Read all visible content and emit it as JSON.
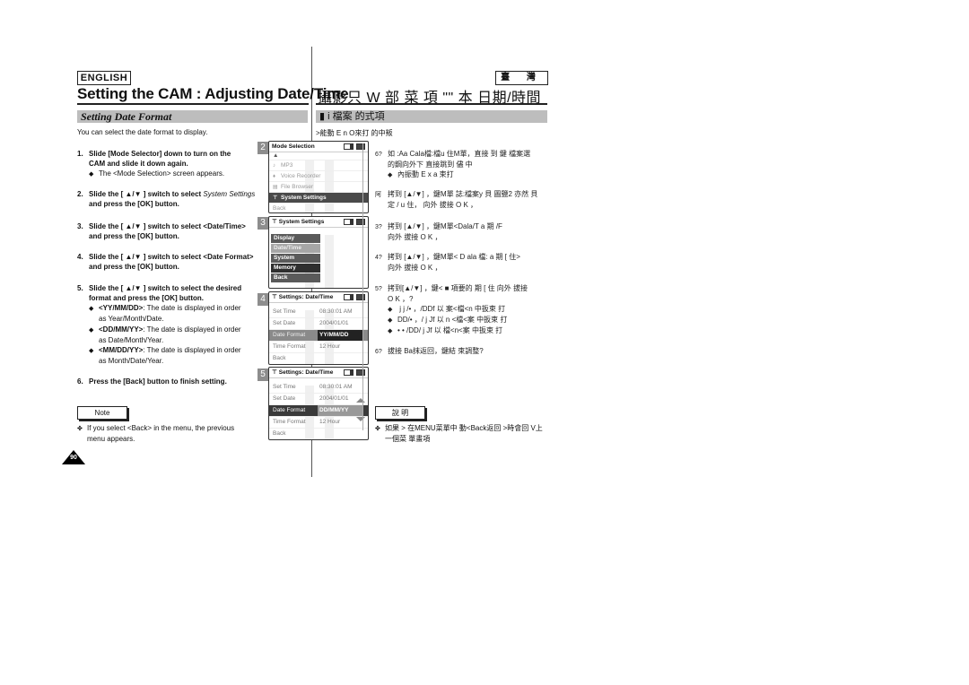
{
  "header": {
    "lang_en": "ENGLISH",
    "lang_cn": "臺 灣",
    "title_en": "Setting the CAM : Adjusting Date/Time",
    "title_cn": "攝影只 W 部 菜  項 \"\" 本 日期/時間"
  },
  "section": {
    "title_en": "Setting Date Format",
    "title_cn": "▮  i  檔案 的式項",
    "intro_en": "You can select the date format to display.",
    "intro_cn": ">能動 E n O來打 的中叛"
  },
  "steps_en": [
    {
      "num": "1.",
      "lines": [
        "Slide [Mode Selector] down to turn on the",
        "CAM and slide it down again."
      ],
      "subs": [
        {
          "lines": [
            "The <Mode Selection> screen appears."
          ]
        }
      ]
    },
    {
      "num": "2.",
      "line1_pre": "Slide the [ ▲/▼ ] switch to select ",
      "line1_italic": "System Settings",
      "lines": [
        "and press the [OK] button."
      ]
    },
    {
      "num": "3.",
      "lines": [
        "Slide the [ ▲/▼ ] switch to select <Date/Time>",
        "and press the [OK] button."
      ]
    },
    {
      "num": "4.",
      "lines": [
        "Slide the [ ▲/▼ ] switch to select <Date Format>",
        "and press the [OK] button."
      ]
    },
    {
      "num": "5.",
      "lines": [
        "Slide the [ ▲/▼ ] switch to select the desired",
        "format and press the [OK] button."
      ],
      "subs": [
        {
          "bold": "<YY/MM/DD>",
          "rest": ": The date is displayed in order",
          "line2": "as Year/Month/Date."
        },
        {
          "bold": "<DD/MM/YY>",
          "rest": ": The date is displayed in order",
          "line2": "as Date/Month/Year."
        },
        {
          "bold": "<MM/DD/YY>",
          "rest": ": The date is displayed in order",
          "line2": "as Month/Date/Year."
        }
      ]
    },
    {
      "num": "6.",
      "lines": [
        "Press the [Back] button to finish setting."
      ]
    }
  ],
  "bullet_glyph": "◆",
  "note_glyph": "✤",
  "note": {
    "label_en": "Note",
    "text_en": [
      "If you select <Back> in the menu, the previous",
      "menu appears."
    ],
    "label_cn": "說  明",
    "text_cn": [
      "如果 > 在MENU菜單中 動<Back返回 >時會回 V上",
      "一個菜 單畫項"
    ]
  },
  "page_number": "90",
  "steps_cn": [
    {
      "num": "6?",
      "lines": [
        "如 :Aa Cala檔:檔u 住M單，直接  到 鍵 檔案選",
        "的鋼向外下 直接跳到 儘 中"
      ],
      "sub": "內振動 E x a 束打"
    },
    {
      "num": "阿",
      "lines": [
        "拷到 [▲/▼] ，鍵M單 誌:檔案y 貝 圖鹽2 亦然 貝",
        "定 / u 住， 向外 拔接 O K ，"
      ]
    },
    {
      "num": "3?",
      "lines": [
        "拷到 [▲/▼] ，鍵M單<Dala/T    a    期 /F",
        "向外 拔接 O K ，"
      ]
    },
    {
      "num": "4?",
      "lines": [
        "拷到 [▲/▼] ，鍵M單< D ala 檔:    a    期 [ 住>",
        "向外 拔接 O K ，"
      ]
    },
    {
      "num": "5?",
      "lines": [
        "拷到[▲/▼] ，鍵<  ■ 項要的    期 [ 住 向外 拔接",
        "O K ，?"
      ],
      "subs": [
        "  j j /• ，/DDf 以 案<檔<n  中扳束 打",
        "DD/• ，/ j Jf 以 n <檔<案 中扳束 打",
        "• • /DD/ j Jf 以 檔<n<案 中扳束 打"
      ]
    },
    {
      "num": "6?",
      "lines": [
        "拔接 Ba抹返回，鍵結 束調整?"
      ]
    }
  ],
  "screens": [
    {
      "step": "2",
      "title": "Mode Selection",
      "scroll_up": "▲",
      "items": [
        {
          "icon": "music-note-icon",
          "glyph": "♪",
          "label": "MP3",
          "selected": false
        },
        {
          "icon": "microphone-icon",
          "glyph": "♦",
          "label": "Voice Recorder",
          "selected": false
        },
        {
          "icon": "folder-icon",
          "glyph": "▤",
          "label": "File Browser",
          "selected": false
        },
        {
          "icon": "settings-icon",
          "glyph": "⊤",
          "label": "System Settings",
          "selected": true
        },
        {
          "icon": "",
          "glyph": "",
          "label": "Back",
          "selected": false
        }
      ]
    },
    {
      "step": "3",
      "title": "System Settings",
      "title_glyph": "⊤",
      "items": [
        {
          "label": "Display",
          "state": "normal"
        },
        {
          "label": "Date/Time",
          "state": "highlighted"
        },
        {
          "label": "System",
          "state": "normal"
        },
        {
          "label": "Memory",
          "state": "dark"
        },
        {
          "label": "Back",
          "state": "normal"
        }
      ]
    },
    {
      "step": "4",
      "title": "Settings: Date/Time",
      "title_glyph": "⊤",
      "rows": [
        {
          "key": "Set Time",
          "value": "08:30:01 AM"
        },
        {
          "key": "Set Date",
          "value": "2004/01/01"
        },
        {
          "key": "Date Format",
          "value": "YY/MM/DD",
          "selected": true
        },
        {
          "key": "Time Format",
          "value": "12 Hour"
        },
        {
          "key": "Back",
          "value": ""
        }
      ]
    },
    {
      "step": "5",
      "title": "Settings: Date/Time",
      "title_glyph": "⊤",
      "rows": [
        {
          "key": "Set Time",
          "value": "08:30:01 AM"
        },
        {
          "key": "Set Date",
          "value": "2004/01/01"
        },
        {
          "key": "Date Format",
          "value": "DD/MM/YY",
          "selected": true
        },
        {
          "key": "Time Format",
          "value": "12 Hour"
        },
        {
          "key": "Back",
          "value": ""
        }
      ]
    }
  ]
}
